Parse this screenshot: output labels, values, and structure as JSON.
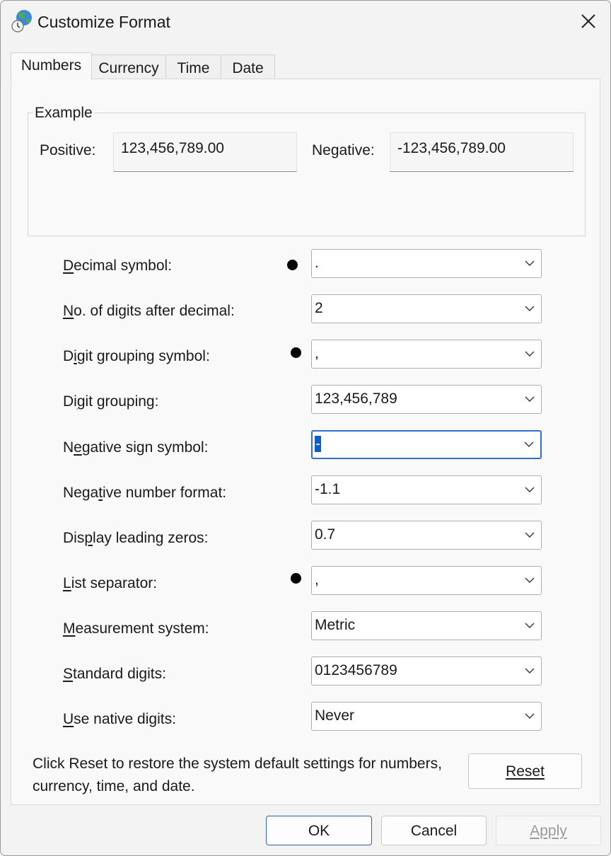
{
  "window": {
    "title": "Customize Format"
  },
  "tabs": [
    {
      "label": "Numbers",
      "active": true
    },
    {
      "label": "Currency"
    },
    {
      "label": "Time"
    },
    {
      "label": "Date"
    }
  ],
  "example": {
    "title": "Example",
    "positive_label": "Positive:",
    "positive_value": "123,456,789.00",
    "negative_label": "Negative:",
    "negative_value": "-123,456,789.00"
  },
  "fields": [
    {
      "label": "Decimal symbol:",
      "mnemonic": "D",
      "value": ".",
      "marked": true
    },
    {
      "label": "No. of digits after decimal:",
      "mnemonic": "N",
      "value": "2"
    },
    {
      "label": "Digit grouping symbol:",
      "mnemonic": "i",
      "value": ",",
      "marked": true
    },
    {
      "label": "Digit grouping:",
      "mnemonic": "g",
      "value": "123,456,789"
    },
    {
      "label": "Negative sign symbol:",
      "mnemonic": "e",
      "value": "-",
      "focused": true
    },
    {
      "label": "Negative number format:",
      "mnemonic": "t",
      "value": "-1.1"
    },
    {
      "label": "Display leading zeros:",
      "mnemonic": "p",
      "value": "0.7"
    },
    {
      "label": "List separator:",
      "mnemonic": "L",
      "value": ",",
      "marked": true
    },
    {
      "label": "Measurement system:",
      "mnemonic": "M",
      "value": "Metric"
    },
    {
      "label": "Standard digits:",
      "mnemonic": "S",
      "value": "0123456789"
    },
    {
      "label": "Use native digits:",
      "mnemonic": "U",
      "value": "Never"
    }
  ],
  "reset": {
    "note": "Click Reset to restore the system default settings for numbers, currency, time, and date.",
    "button_label": "Reset"
  },
  "footer": {
    "ok_label": "OK",
    "cancel_label": "Cancel",
    "apply_label": "Apply",
    "apply_enabled": false
  },
  "colors": {
    "focus_border": "#2f6fcf",
    "selection": "#0a5fd0",
    "window_bg": "#f3f3f3"
  }
}
